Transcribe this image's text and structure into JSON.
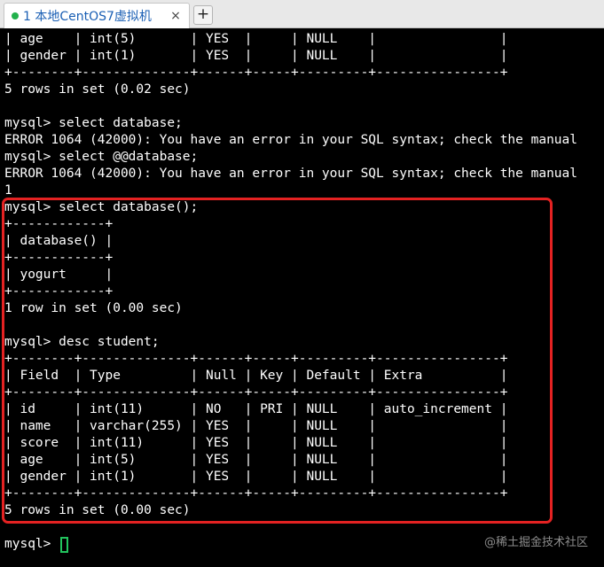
{
  "tabbar": {
    "tab_title": "1 本地CentOS7虚拟机",
    "close_icon": "×",
    "new_tab_icon": "+"
  },
  "terminal": {
    "lines": [
      "| age    | int(5)       | YES  |     | NULL    |                |",
      "| gender | int(1)       | YES  |     | NULL    |                |",
      "+--------+--------------+------+-----+---------+----------------+",
      "5 rows in set (0.02 sec)",
      "",
      "mysql> select database;",
      "ERROR 1064 (42000): You have an error in your SQL syntax; check the manual",
      "mysql> select @@database;",
      "ERROR 1064 (42000): You have an error in your SQL syntax; check the manual",
      "1",
      "mysql> select database();",
      "+------------+",
      "| database() |",
      "+------------+",
      "| yogurt     |",
      "+------------+",
      "1 row in set (0.00 sec)",
      "",
      "mysql> desc student;",
      "+--------+--------------+------+-----+---------+----------------+",
      "| Field  | Type         | Null | Key | Default | Extra          |",
      "+--------+--------------+------+-----+---------+----------------+",
      "| id     | int(11)      | NO   | PRI | NULL    | auto_increment |",
      "| name   | varchar(255) | YES  |     | NULL    |                |",
      "| score  | int(11)      | YES  |     | NULL    |                |",
      "| age    | int(5)       | YES  |     | NULL    |                |",
      "| gender | int(1)       | YES  |     | NULL    |                |",
      "+--------+--------------+------+-----+---------+----------------+",
      "5 rows in set (0.00 sec)",
      "",
      "mysql> "
    ],
    "cursor_color": "#22c55e",
    "highlight_color": "#e42222"
  },
  "watermark": "@稀土掘金技术社区"
}
